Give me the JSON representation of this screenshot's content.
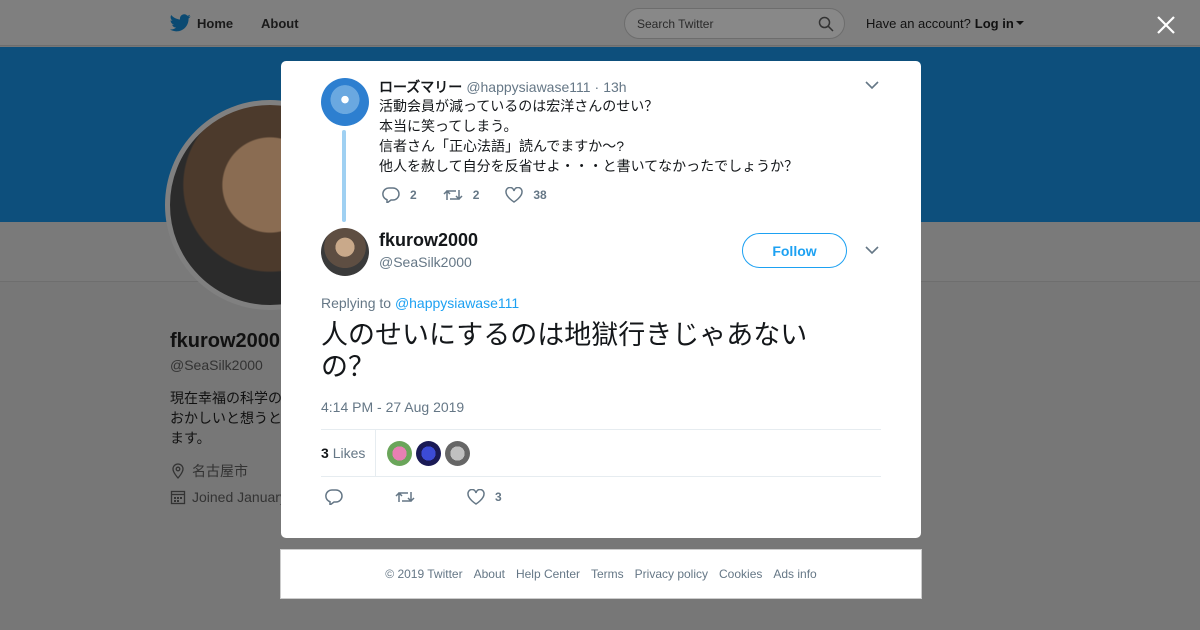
{
  "nav": {
    "home_label": "Home",
    "about_label": "About",
    "search_placeholder": "Search Twitter",
    "account_prompt": "Have an account?",
    "login_label": "Log in"
  },
  "background_profile": {
    "name": "fkurow2000",
    "handle": "@SeaSilk2000",
    "bio_lines": [
      "現在幸福の科学の",
      "おかしいと想うと",
      "ます。"
    ],
    "location": "名古屋市",
    "joined": "Joined January"
  },
  "parent_tweet": {
    "name": "ローズマリー",
    "handle": "@happysiawase111",
    "separator": "·",
    "time": "13h",
    "lines": [
      "活動会員が減っているのは宏洋さんのせい？",
      "本当に笑ってしまう。",
      "信者さん「正心法語」読んでますか～?",
      "他人を赦して自分を反省せよ・・・と書いてなかったでしょうか？"
    ],
    "reply_count": "2",
    "retweet_count": "2",
    "like_count": "38"
  },
  "main_tweet": {
    "name": "fkurow2000",
    "handle": "@SeaSilk2000",
    "follow_label": "Follow",
    "replying_prefix": "Replying to",
    "replying_to": "@happysiawase111",
    "text": "人のせいにするのは地獄行きじゃあないの？",
    "timestamp": "4:14 PM - 27 Aug 2019",
    "likes_number": "3",
    "likes_label": "Likes",
    "like_count": "3"
  },
  "footer": {
    "copyright": "© 2019 Twitter",
    "about": "About",
    "help": "Help Center",
    "terms": "Terms",
    "privacy": "Privacy policy",
    "cookies": "Cookies",
    "ads": "Ads info"
  },
  "colors": {
    "brand": "#1da1f2",
    "overlay": "#777777",
    "banner": "#0d4f7c",
    "secondary_text": "#657786"
  }
}
